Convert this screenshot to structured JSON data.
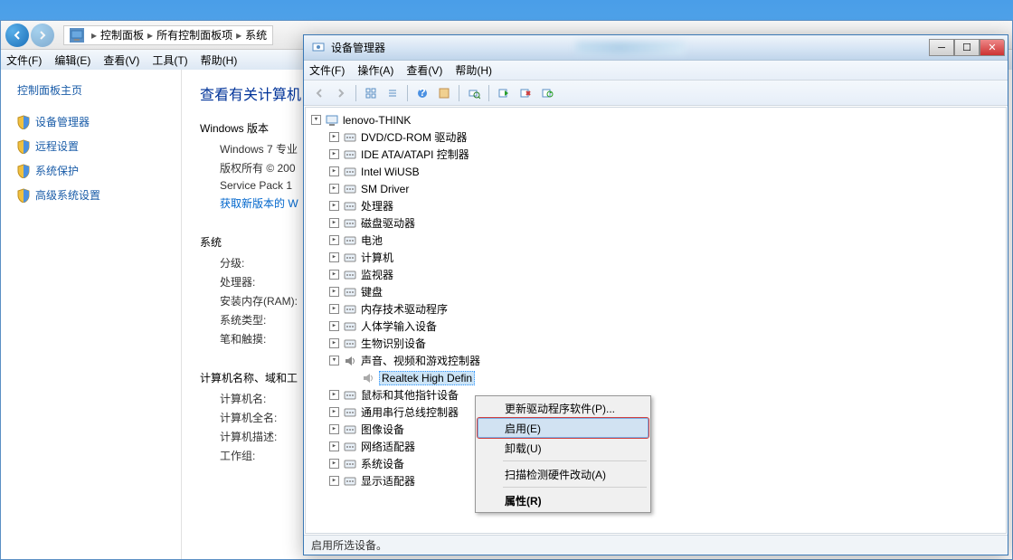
{
  "cp": {
    "breadcrumb": {
      "root": "控制面板",
      "mid": "所有控制面板项",
      "leaf": "系统"
    },
    "menu": {
      "file": "文件(F)",
      "edit": "编辑(E)",
      "view": "查看(V)",
      "tools": "工具(T)",
      "help": "帮助(H)"
    },
    "sidebar": {
      "heading": "控制面板主页",
      "items": [
        {
          "label": "设备管理器"
        },
        {
          "label": "远程设置"
        },
        {
          "label": "系统保护"
        },
        {
          "label": "高级系统设置"
        }
      ]
    },
    "main": {
      "title": "查看有关计算机",
      "win_ver_heading": "Windows 版本",
      "win_ver": "Windows 7 专业",
      "copyright": "版权所有 © 200",
      "sp": "Service Pack 1",
      "get_new": "获取新版本的 W",
      "sys_heading": "系统",
      "rows": [
        {
          "k": "分级:"
        },
        {
          "k": "处理器:"
        },
        {
          "k": "安装内存(RAM):"
        },
        {
          "k": "系统类型:"
        },
        {
          "k": "笔和触摸:"
        }
      ],
      "comp_heading": "计算机名称、域和工",
      "comp_rows": [
        {
          "k": "计算机名:"
        },
        {
          "k": "计算机全名:"
        },
        {
          "k": "计算机描述:"
        },
        {
          "k": "工作组:"
        }
      ]
    }
  },
  "dm": {
    "title": "设备管理器",
    "menu": {
      "file": "文件(F)",
      "action": "操作(A)",
      "view": "查看(V)",
      "help": "帮助(H)"
    },
    "root": "lenovo-THINK",
    "nodes": [
      {
        "label": "DVD/CD-ROM 驱动器",
        "expand": "plus"
      },
      {
        "label": "IDE ATA/ATAPI 控制器",
        "expand": "plus"
      },
      {
        "label": "Intel WiUSB",
        "expand": "plus"
      },
      {
        "label": "SM Driver",
        "expand": "plus"
      },
      {
        "label": "处理器",
        "expand": "plus"
      },
      {
        "label": "磁盘驱动器",
        "expand": "plus"
      },
      {
        "label": "电池",
        "expand": "plus"
      },
      {
        "label": "计算机",
        "expand": "plus"
      },
      {
        "label": "监视器",
        "expand": "plus"
      },
      {
        "label": "键盘",
        "expand": "plus"
      },
      {
        "label": "内存技术驱动程序",
        "expand": "plus"
      },
      {
        "label": "人体学输入设备",
        "expand": "plus"
      },
      {
        "label": "生物识别设备",
        "expand": "plus"
      },
      {
        "label": "声音、视频和游戏控制器",
        "expand": "minus",
        "children": [
          {
            "label": "Realtek High Defin",
            "selected": true
          }
        ]
      },
      {
        "label": "鼠标和其他指针设备",
        "expand": "plus"
      },
      {
        "label": "通用串行总线控制器",
        "expand": "plus"
      },
      {
        "label": "图像设备",
        "expand": "plus"
      },
      {
        "label": "网络适配器",
        "expand": "plus"
      },
      {
        "label": "系统设备",
        "expand": "plus"
      },
      {
        "label": "显示适配器",
        "expand": "plus"
      }
    ],
    "status": "启用所选设备。"
  },
  "ctx": {
    "update": "更新驱动程序软件(P)...",
    "enable": "启用(E)",
    "uninstall": "卸载(U)",
    "scan": "扫描检测硬件改动(A)",
    "props": "属性(R)"
  }
}
